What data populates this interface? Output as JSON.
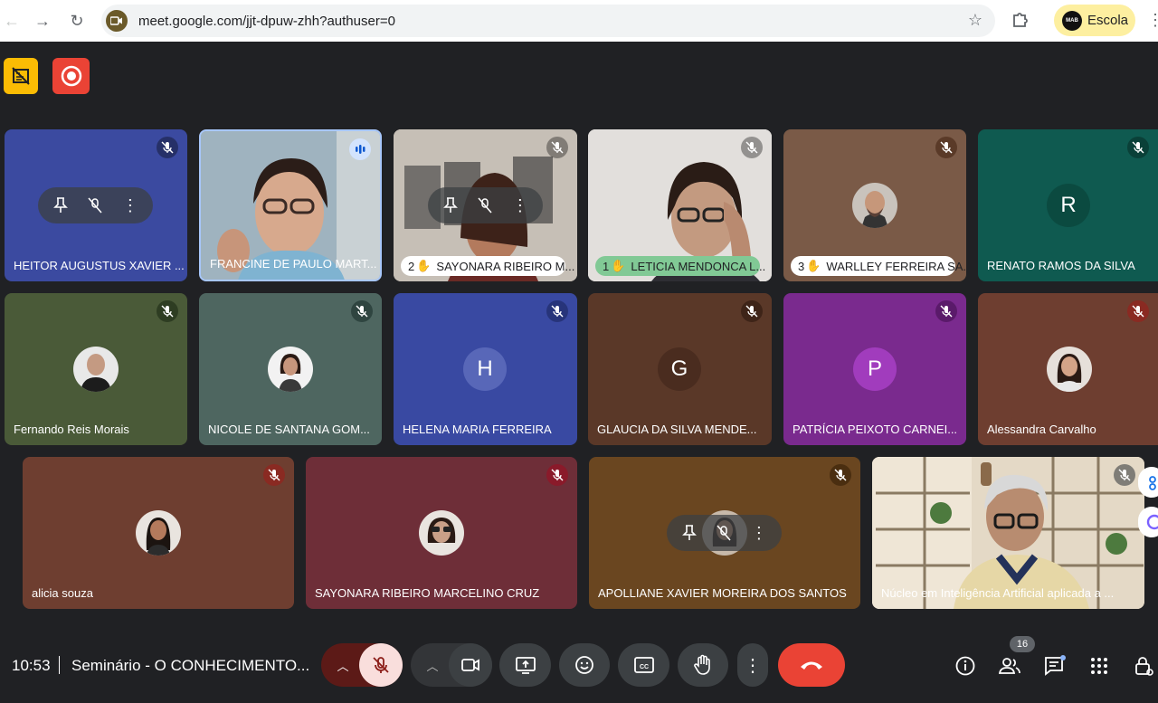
{
  "browser": {
    "url": "meet.google.com/jjt-dpuw-zhh?authuser=0",
    "profile_label": "Escola",
    "profile_avatar_text": "MAB"
  },
  "tiles": [
    {
      "name": "HEITOR AUGUSTUS XAVIER ...",
      "bg": "#3b4aa0"
    },
    {
      "name": "FRANCINE DE PAULO MART...",
      "bg": "#8fa7b8"
    },
    {
      "hand": "2",
      "name": "SAYONARA RIBEIRO M...",
      "bg": "#b9b2a8"
    },
    {
      "hand": "1",
      "name": "LETICIA MENDONCA L...",
      "bg": "#d9d6d2"
    },
    {
      "hand": "3",
      "name": "WARLLEY FERREIRA SA...",
      "bg": "#7a5a47"
    },
    {
      "name": "RENATO RAMOS DA SILVA",
      "letter": "R",
      "bg": "#0f5a50"
    },
    {
      "name": "Fernando Reis Morais",
      "bg": "#4a5a38"
    },
    {
      "name": "NICOLE DE SANTANA GOM...",
      "bg": "#4e6660"
    },
    {
      "name": "HELENA MARIA FERREIRA",
      "letter": "H",
      "bg": "#3949a2"
    },
    {
      "name": "GLAUCIA DA SILVA MENDE...",
      "letter": "G",
      "bg": "#5a3828"
    },
    {
      "name": "PATRÍCIA PEIXOTO CARNEI...",
      "letter": "P",
      "bg": "#7a2a8e"
    },
    {
      "name": "Alessandra Carvalho",
      "bg": "#6e3e30"
    },
    {
      "name": "alicia souza",
      "bg": "#6e3e30"
    },
    {
      "name": "SAYONARA RIBEIRO MARCELINO CRUZ",
      "bg": "#6e2e38"
    },
    {
      "name": "APOLLIANE XAVIER MOREIRA DOS SANTOS",
      "bg": "#6a4620"
    },
    {
      "name": "Núcleo em Inteligência Artificial aplicada a ...",
      "bg": "#d9cdb8"
    }
  ],
  "bottom": {
    "time": "10:53",
    "meeting_title": "Seminário - O CONHECIMENTO...",
    "participants_count": "16"
  },
  "icons": {
    "mic_muted": "mic-off-icon",
    "speaking": "audio-wave-icon",
    "raise_hand": "hand-icon",
    "end_call": "call-end-icon"
  },
  "colors": {
    "background": "#202124",
    "end_call": "#ea4335",
    "mic_off_bg": "#f9dedc",
    "profile_bg": "#fdefa0"
  }
}
